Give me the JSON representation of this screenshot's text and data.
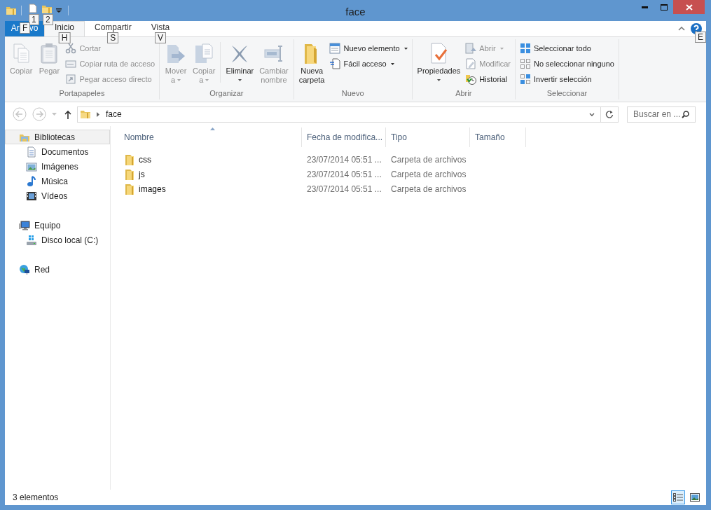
{
  "window": {
    "title": "face"
  },
  "quick_access": [
    {
      "keytip": "1"
    },
    {
      "keytip": "2"
    }
  ],
  "ribbon_tabs": [
    {
      "kind": "file",
      "label_parts": [
        "Ar",
        "vo"
      ],
      "keytip": "F",
      "selected": false
    },
    {
      "kind": "tab",
      "label": "Inicio",
      "keytip": "H",
      "selected": true
    },
    {
      "kind": "tab",
      "label": "Compartir",
      "keytip": "S",
      "selected": false
    },
    {
      "kind": "tab",
      "label": "Vista",
      "keytip": "V",
      "selected": false
    }
  ],
  "help_keytip": "E",
  "ribbon_groups": [
    {
      "label": "Portapapeles",
      "items": [
        {
          "kind": "large",
          "lines": [
            "Copiar"
          ],
          "disabled": true,
          "dropdown": false
        },
        {
          "kind": "large",
          "lines": [
            "Pegar"
          ],
          "disabled": true,
          "dropdown": false
        },
        {
          "kind": "stack",
          "items": [
            {
              "label": "Cortar",
              "disabled": true,
              "dropdown": false
            },
            {
              "label": "Copiar ruta de acceso",
              "disabled": true,
              "dropdown": false
            },
            {
              "label": "Pegar acceso directo",
              "disabled": true,
              "dropdown": false
            }
          ]
        }
      ]
    },
    {
      "label": "Organizar",
      "items": [
        {
          "kind": "large",
          "lines": [
            "Mover",
            "a"
          ],
          "disabled": true,
          "dropdown": true
        },
        {
          "kind": "large",
          "lines": [
            "Copiar",
            "a"
          ],
          "disabled": true,
          "dropdown": true
        },
        {
          "kind": "separator"
        },
        {
          "kind": "large",
          "lines": [
            "Eliminar"
          ],
          "disabled": false,
          "dropdown": true
        },
        {
          "kind": "large",
          "lines": [
            "Cambiar",
            "nombre"
          ],
          "disabled": true,
          "dropdown": false
        }
      ]
    },
    {
      "label": "Nuevo",
      "items": [
        {
          "kind": "large",
          "lines": [
            "Nueva",
            "carpeta"
          ],
          "disabled": false,
          "dropdown": false
        },
        {
          "kind": "stack",
          "items": [
            {
              "label": "Nuevo elemento",
              "disabled": false,
              "dropdown": true
            },
            {
              "label": "Fácil acceso",
              "disabled": false,
              "dropdown": true
            }
          ]
        }
      ]
    },
    {
      "label": "Abrir",
      "items": [
        {
          "kind": "large",
          "lines": [
            "Propiedades"
          ],
          "disabled": false,
          "dropdown": true
        },
        {
          "kind": "stack",
          "items": [
            {
              "label": "Abrir",
              "disabled": true,
              "dropdown": true
            },
            {
              "label": "Modificar",
              "disabled": true,
              "dropdown": false
            },
            {
              "label": "Historial",
              "disabled": false,
              "dropdown": false
            }
          ]
        }
      ]
    },
    {
      "label": "Seleccionar",
      "items": [
        {
          "kind": "stack",
          "items": [
            {
              "label": "Seleccionar todo",
              "disabled": false,
              "dropdown": false
            },
            {
              "label": "No seleccionar ninguno",
              "disabled": false,
              "dropdown": false
            },
            {
              "label": "Invertir selección",
              "disabled": false,
              "dropdown": false
            }
          ]
        }
      ]
    }
  ],
  "address_bar": {
    "path": [
      "face"
    ]
  },
  "search": {
    "placeholder": "Buscar en ..."
  },
  "navigation": [
    {
      "label": "Bibliotecas",
      "selected": true,
      "children": [
        {
          "label": "Documentos",
          "selected": false
        },
        {
          "label": "Imágenes",
          "selected": false
        },
        {
          "label": "Música",
          "selected": false
        },
        {
          "label": "Vídeos",
          "selected": false
        }
      ]
    },
    {
      "label": "Equipo",
      "selected": false,
      "children": [
        {
          "label": "Disco local (C:)",
          "selected": false
        }
      ]
    },
    {
      "label": "Red",
      "selected": false
    }
  ],
  "file_list": {
    "columns": [
      {
        "label": "Nombre",
        "sorted": true
      },
      {
        "label": "Fecha de modifica...",
        "sorted": false
      },
      {
        "label": "Tipo",
        "sorted": false
      },
      {
        "label": "Tamaño",
        "sorted": false
      }
    ],
    "rows": [
      {
        "name": "css",
        "date": "23/07/2014 05:51 ...",
        "type": "Carpeta de archivos",
        "selected": false
      },
      {
        "name": "js",
        "date": "23/07/2014 05:51 ...",
        "type": "Carpeta de archivos",
        "selected": false
      },
      {
        "name": "images",
        "date": "23/07/2014 05:51 ...",
        "type": "Carpeta de archivos",
        "selected": false
      }
    ]
  },
  "status_bar": {
    "text": "3 elementos"
  },
  "view_buttons": [
    {
      "selected": true
    },
    {
      "selected": false
    }
  ]
}
